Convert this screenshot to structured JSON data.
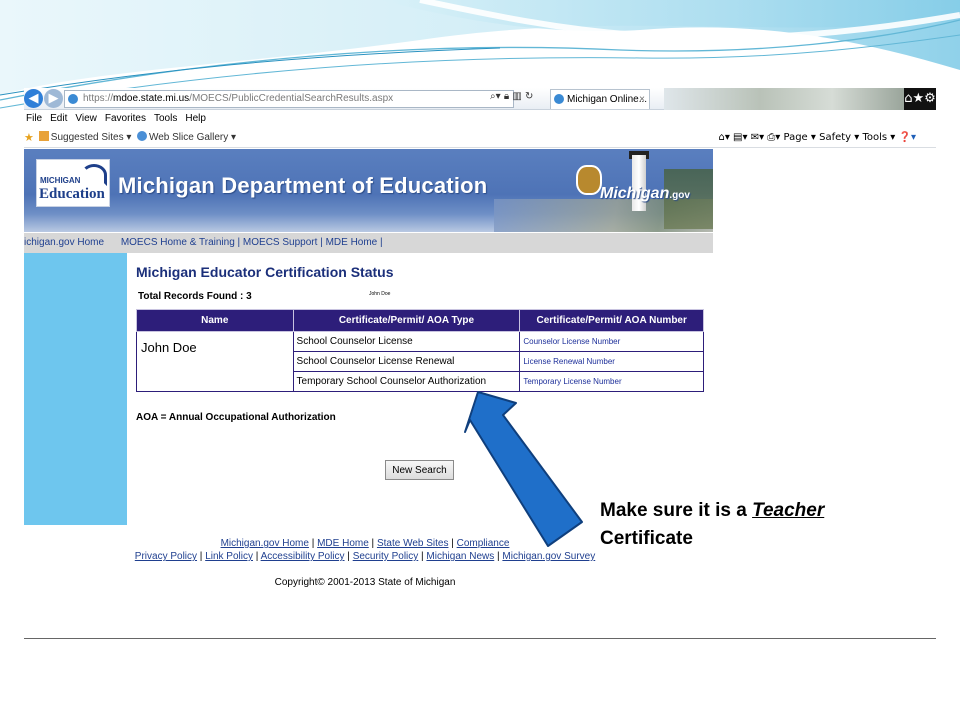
{
  "colors": {
    "banner_blue": "#4e73b6",
    "table_header": "#2d1e7a",
    "sidebar": "#6ec6ee",
    "arrow_blue": "#1f6fc9",
    "link_blue": "#1f3f8f"
  },
  "browser": {
    "url_scheme": "https://",
    "url_host": "mdoe.state.mi.us",
    "url_path": "/MOECS/PublicCredentialSearchResults.aspx",
    "tab_title": "Michigan Online...",
    "tab_close": "×",
    "menu": [
      "File",
      "Edit",
      "View",
      "Favorites",
      "Tools",
      "Help"
    ],
    "favorites": {
      "suggested": "Suggested Sites ▾",
      "webslice": "Web Slice Gallery ▾"
    },
    "command_bar": {
      "page": "Page ▾",
      "safety": "Safety ▾",
      "tools": "Tools ▾"
    },
    "icons": [
      "back-icon",
      "forward-icon",
      "search-icon",
      "lock-icon",
      "refresh-icon",
      "home-icon",
      "star-icon",
      "gear-icon"
    ]
  },
  "site": {
    "logo_top": "MICHIGAN",
    "logo_bottom": "Education",
    "banner_title": "Michigan Department of Education",
    "portal_name": "Michigan",
    "portal_suffix": ".gov",
    "nav": {
      "home": "ichigan.gov Home",
      "moecs_training": "MOECS Home & Training",
      "sep1": " | ",
      "moecs_support": "MOECS Support",
      "sep2": " | ",
      "mde_home": "MDE Home",
      "sep3": " |"
    }
  },
  "content": {
    "heading": "Michigan Educator Certification Status",
    "records_label": "Total Records Found : 3",
    "tiny_name": "John Doe",
    "table": {
      "headers": [
        "Name",
        "Certificate/Permit/ AOA Type",
        "Certificate/Permit/ AOA Number"
      ],
      "name": "John Doe",
      "rows": [
        {
          "type": "School Counselor License",
          "number": "Counselor License Number"
        },
        {
          "type": "School Counselor License Renewal",
          "number": "License Renewal Number"
        },
        {
          "type": "Temporary School Counselor Authorization",
          "number": "Temporary License Number"
        }
      ]
    },
    "aoa_note": "AOA = Annual Occupational Authorization",
    "new_search_label": "New Search"
  },
  "footer": {
    "line1": [
      "Michigan.gov Home",
      "MDE Home",
      "State Web Sites",
      "Compliance"
    ],
    "line2": [
      "Privacy Policy",
      "Link Policy",
      "Accessibility Policy",
      "Security Policy",
      "Michigan News",
      "Michigan.gov Survey"
    ],
    "copyright": "Copyright© 2001-2013 State of Michigan"
  },
  "annotation": {
    "line1_prefix": "Make sure it is a ",
    "emphasis": "Teacher",
    "line2": "Certificate"
  }
}
